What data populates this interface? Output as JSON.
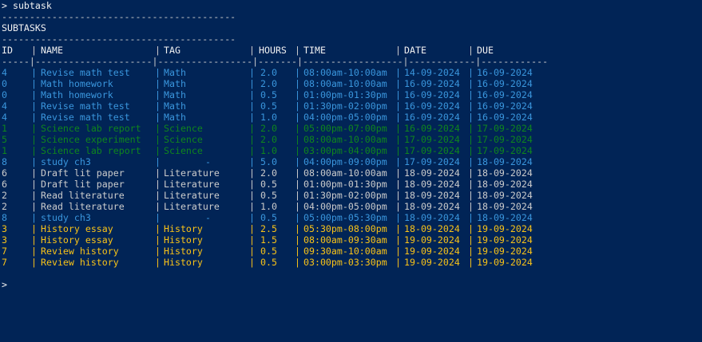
{
  "prompt": "> subtask",
  "rule1": "------------------------------------------",
  "heading": "SUBTASKS",
  "rule2": "------------------------------------------",
  "headers": {
    "id": "ID",
    "name": "NAME",
    "tag": "TAG",
    "hours": "HOURS",
    "time": "TIME",
    "date": "DATE",
    "due": "DUE"
  },
  "divider": "-----|---------------------|-----------------|-------|------------------|------------|------------",
  "rows": [
    {
      "id": "4",
      "name": "Revise math test",
      "tag": "Math",
      "hours": "2.0",
      "time": "08:00am-10:00am",
      "date": "14-09-2024",
      "due": "16-09-2024",
      "color": "blue"
    },
    {
      "id": "0",
      "name": "Math homework",
      "tag": "Math",
      "hours": "2.0",
      "time": "08:00am-10:00am",
      "date": "16-09-2024",
      "due": "16-09-2024",
      "color": "blue"
    },
    {
      "id": "0",
      "name": "Math homework",
      "tag": "Math",
      "hours": "0.5",
      "time": "01:00pm-01:30pm",
      "date": "16-09-2024",
      "due": "16-09-2024",
      "color": "blue"
    },
    {
      "id": "4",
      "name": "Revise math test",
      "tag": "Math",
      "hours": "0.5",
      "time": "01:30pm-02:00pm",
      "date": "16-09-2024",
      "due": "16-09-2024",
      "color": "blue"
    },
    {
      "id": "4",
      "name": "Revise math test",
      "tag": "Math",
      "hours": "1.0",
      "time": "04:00pm-05:00pm",
      "date": "16-09-2024",
      "due": "16-09-2024",
      "color": "blue"
    },
    {
      "id": "1",
      "name": "Science lab report",
      "tag": "Science",
      "hours": "2.0",
      "time": "05:00pm-07:00pm",
      "date": "16-09-2024",
      "due": "17-09-2024",
      "color": "green"
    },
    {
      "id": "5",
      "name": "Science experiment",
      "tag": "Science",
      "hours": "2.0",
      "time": "08:00am-10:00am",
      "date": "17-09-2024",
      "due": "17-09-2024",
      "color": "green"
    },
    {
      "id": "1",
      "name": "Science lab report",
      "tag": "Science",
      "hours": "1.0",
      "time": "03:00pm-04:00pm",
      "date": "17-09-2024",
      "due": "17-09-2024",
      "color": "green"
    },
    {
      "id": "8",
      "name": "study ch3",
      "tag": "-",
      "hours": "5.0",
      "time": "04:00pm-09:00pm",
      "date": "17-09-2024",
      "due": "18-09-2024",
      "color": "blue"
    },
    {
      "id": "6",
      "name": "Draft lit paper",
      "tag": "Literature",
      "hours": "2.0",
      "time": "08:00am-10:00am",
      "date": "18-09-2024",
      "due": "18-09-2024",
      "color": "gray"
    },
    {
      "id": "6",
      "name": "Draft lit paper",
      "tag": "Literature",
      "hours": "0.5",
      "time": "01:00pm-01:30pm",
      "date": "18-09-2024",
      "due": "18-09-2024",
      "color": "gray"
    },
    {
      "id": "2",
      "name": "Read literature",
      "tag": "Literature",
      "hours": "0.5",
      "time": "01:30pm-02:00pm",
      "date": "18-09-2024",
      "due": "18-09-2024",
      "color": "gray"
    },
    {
      "id": "2",
      "name": "Read literature",
      "tag": "Literature",
      "hours": "1.0",
      "time": "04:00pm-05:00pm",
      "date": "18-09-2024",
      "due": "18-09-2024",
      "color": "gray"
    },
    {
      "id": "8",
      "name": "study ch3",
      "tag": "-",
      "hours": "0.5",
      "time": "05:00pm-05:30pm",
      "date": "18-09-2024",
      "due": "18-09-2024",
      "color": "blue"
    },
    {
      "id": "3",
      "name": "History essay",
      "tag": "History",
      "hours": "2.5",
      "time": "05:30pm-08:00pm",
      "date": "18-09-2024",
      "due": "19-09-2024",
      "color": "yellow"
    },
    {
      "id": "3",
      "name": "History essay",
      "tag": "History",
      "hours": "1.5",
      "time": "08:00am-09:30am",
      "date": "19-09-2024",
      "due": "19-09-2024",
      "color": "yellow"
    },
    {
      "id": "7",
      "name": "Review history",
      "tag": "History",
      "hours": "0.5",
      "time": "09:30am-10:00am",
      "date": "19-09-2024",
      "due": "19-09-2024",
      "color": "yellow"
    },
    {
      "id": "7",
      "name": "Review history",
      "tag": "History",
      "hours": "0.5",
      "time": "03:00pm-03:30pm",
      "date": "19-09-2024",
      "due": "19-09-2024",
      "color": "yellow"
    }
  ],
  "final_prompt": ">",
  "colors": {
    "background": "#012456",
    "blue": "#3a96dd",
    "green": "#13a10e",
    "gray": "#cccccc",
    "yellow": "#f9c318",
    "white": "#f2f2f2"
  }
}
